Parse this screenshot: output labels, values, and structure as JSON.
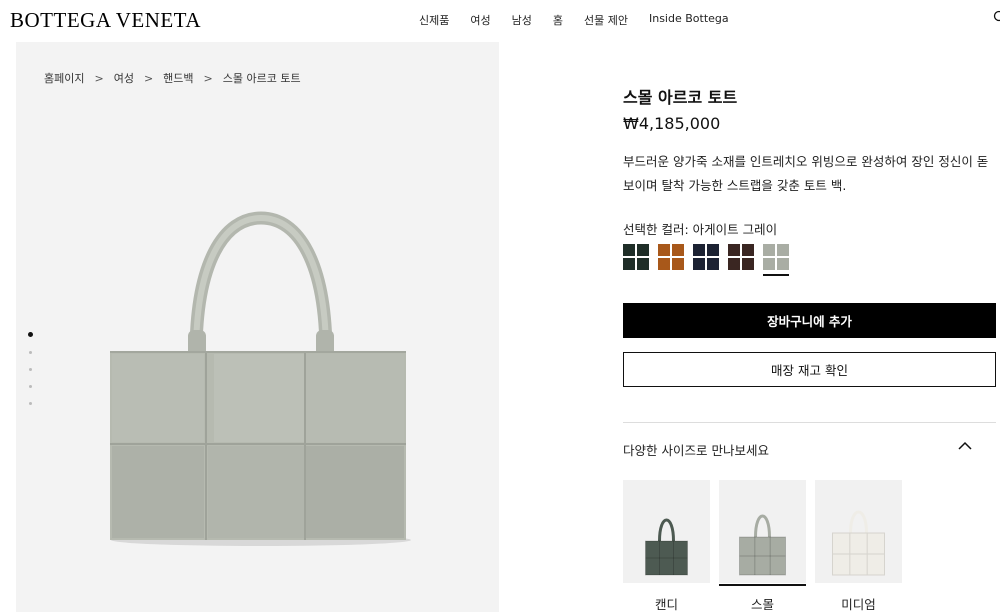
{
  "header": {
    "logo": "BOTTEGA VENETA",
    "nav": [
      "신제품",
      "여성",
      "남성",
      "홈",
      "선물 제안",
      "Inside Bottega"
    ],
    "search_icon": "search-icon"
  },
  "breadcrumb": [
    "홈페이지",
    "여성",
    "핸드백",
    "스몰 아르코 토트"
  ],
  "breadcrumb_separator": ">",
  "gallery": {
    "image_count": 5,
    "active_index": 0
  },
  "product": {
    "title": "스몰 아르코 토트",
    "price": "₩4,185,000",
    "description": "부드러운 양가죽 소재를 인트레치오 위빙으로 완성하여 장인 정신이 돋보이며 탈착 가능한 스트랩을 갖춘 토트 백.",
    "color_label": "선택한 컬러: 아게이트 그레이",
    "swatches": [
      {
        "color": "#1f2e28",
        "selected": false
      },
      {
        "color": "#a8581a",
        "selected": false
      },
      {
        "color": "#1c2233",
        "selected": false
      },
      {
        "color": "#3a2622",
        "selected": false
      },
      {
        "color": "#a9ada4",
        "selected": true
      }
    ],
    "add_to_cart": "장바구니에 추가",
    "check_stock": "매장 재고 확인",
    "sizes_heading": "다양한 사이즈로 만나보세요",
    "sizes": [
      {
        "name": "캔디",
        "color": "#4d5a52",
        "selected": false
      },
      {
        "name": "스몰",
        "color": "#a7aca3",
        "selected": true
      },
      {
        "name": "미디엄",
        "color": "#efede7",
        "selected": false
      }
    ]
  }
}
